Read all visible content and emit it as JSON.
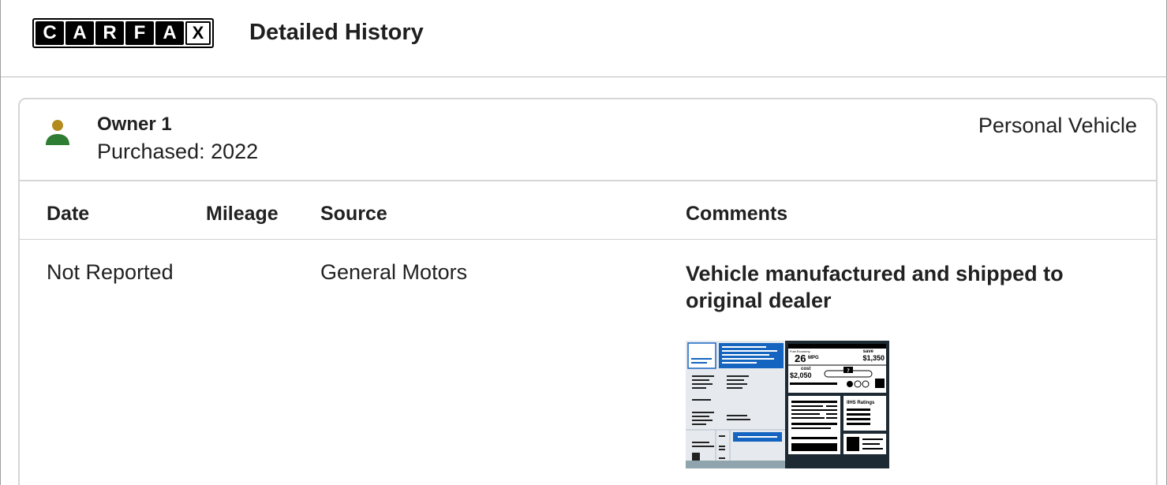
{
  "header": {
    "logo_letters": [
      "C",
      "A",
      "R",
      "F",
      "A",
      "X"
    ],
    "title": "Detailed History"
  },
  "owner": {
    "title": "Owner 1",
    "purchased": "Purchased: 2022",
    "type": "Personal Vehicle",
    "icon": "person-icon",
    "icon_colors": {
      "head": "#b38a1d",
      "body": "#2e7d32"
    }
  },
  "table": {
    "columns": [
      "Date",
      "Mileage",
      "Source",
      "Comments"
    ],
    "rows": [
      {
        "date": "Not Reported",
        "mileage": "",
        "source": "General Motors",
        "comment": "Vehicle manufactured and shipped to original dealer",
        "comment_line1": "Vehicle manufactured and shipped to",
        "comment_line2": "original dealer"
      }
    ]
  },
  "window_sticker": {
    "fuel_economy_label": "Fuel Economy",
    "mpg": "26",
    "mpg_unit": "MPG",
    "save_label": "save",
    "save_amount": "$1,350",
    "cost_label": "cost",
    "cost_amount": "$2,050",
    "rating": "7",
    "safety_title": "IIHS Ratings"
  },
  "colors": {
    "accent_blue": "#1565c0",
    "border": "#d6d6d6"
  }
}
